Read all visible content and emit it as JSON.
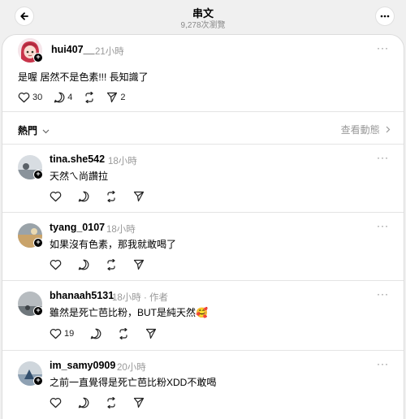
{
  "header": {
    "title": "串文",
    "views": "9,278次瀏覽"
  },
  "main_post": {
    "username": "hui407__",
    "time": "21小時",
    "text": "是喔 居然不是色素!!! 長知識了",
    "likes": "30",
    "comments": "4",
    "shares": "2"
  },
  "sort": {
    "label": "熱門",
    "view_activity": "查看動態"
  },
  "replies": [
    {
      "username": "tina.she542",
      "time": "18小時",
      "text": "天然ㄟ尚讚拉",
      "likes": ""
    },
    {
      "username": "tyang_0107",
      "time": "18小時",
      "text": "如果沒有色素，那我就敢喝了",
      "likes": ""
    },
    {
      "username": "bhanaah5131",
      "time": "18小時 · 作者",
      "text": "雖然是死亡芭比粉，BUT是純天然🥰",
      "likes": "19"
    },
    {
      "username": "im_samy0909",
      "time": "20小時",
      "text": "之前一直覺得是死亡芭比粉XDD不敢喝",
      "likes": ""
    }
  ],
  "colors": {
    "background": "#f0f0f0",
    "card": "#ffffff",
    "muted": "#999999"
  },
  "icons": [
    "back-arrow-icon",
    "more-icon",
    "heart-icon",
    "comment-icon",
    "repost-icon",
    "send-icon",
    "chevron-down-icon",
    "chevron-right-icon",
    "plus-icon"
  ]
}
